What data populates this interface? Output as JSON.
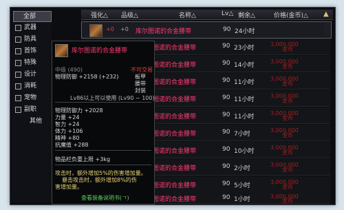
{
  "categories": [
    "全部",
    "武器",
    "防具",
    "首饰",
    "特殊",
    "设计",
    "消耗",
    "宠物",
    "副职",
    "其他"
  ],
  "header": {
    "col1": "强化△",
    "col2": "品级△",
    "col3": "名称△",
    "col4": "Lv△",
    "col5": "剩余△",
    "col6": "价格(金币)△",
    "sort_icon": "hammer-icon"
  },
  "rows": [
    {
      "a": "+0",
      "b": "+0",
      "name": "库尔图诺的合金腰带",
      "lv": "90",
      "time": "24小时",
      "price": "",
      "unit": ""
    },
    {
      "name": "图诺的合金腰带",
      "lv": "90",
      "time": "23小时",
      "price": "3,000,000",
      "unit": "金币"
    },
    {
      "name": "图诺的合金腰带",
      "lv": "90",
      "time": "14小时",
      "price": "3,000,000",
      "unit": "金币"
    },
    {
      "name": "图诺的合金腰带",
      "lv": "90",
      "time": "11小时",
      "price": "3,000,000",
      "unit": "金币"
    },
    {
      "name": "图诺的合金腰带",
      "lv": "90",
      "time": "11小时",
      "price": "3,000,000",
      "unit": "金币"
    },
    {
      "name": "图诺的合金腰带",
      "lv": "90",
      "time": "11小时",
      "price": "3,000,000",
      "unit": "金币"
    },
    {
      "name": "图诺的合金腰带",
      "lv": "90",
      "time": "7小时",
      "price": "3,000,000",
      "unit": "金币"
    },
    {
      "name": "图诺的合金腰带",
      "lv": "90",
      "time": "10小时",
      "price": "3,000,000",
      "unit": "金币"
    },
    {
      "name": "图诺的合金腰带",
      "lv": "90",
      "time": "2小时",
      "price": "3,000,000",
      "unit": "金币"
    },
    {
      "name": "图诺的合金腰带",
      "lv": "90",
      "time": "5小时",
      "price": "3,000,000",
      "unit": "金币"
    },
    {
      "name": "图诺的合金腰带",
      "lv": "90",
      "time": "1小时",
      "price": "3,000,000",
      "unit": "金币"
    }
  ],
  "tooltip": {
    "title": "库尔图诺的合金腰带",
    "grade": "中级 (490)",
    "defense": "物理防御 +2158 (+232)",
    "type1": "不可交易",
    "type2": "板甲",
    "type3": "腰带",
    "type4": "封装",
    "usable": "Lv86以上可以使用 (Lv90 ~ 100)",
    "stats": [
      "物理防御力 +2028",
      "力量 +24",
      "智力 +24",
      "体力 +106",
      "精神 +80",
      "抗魔值 +288"
    ],
    "weight": "物品栏负重上限 +3kg",
    "desc1": "攻击时，额外增加5%的伤害增加量。",
    "desc2": "暴击攻击时，额外增加8%的伤",
    "desc3": "害增加量。",
    "link": "查看装备说明书(ㄱ)"
  }
}
